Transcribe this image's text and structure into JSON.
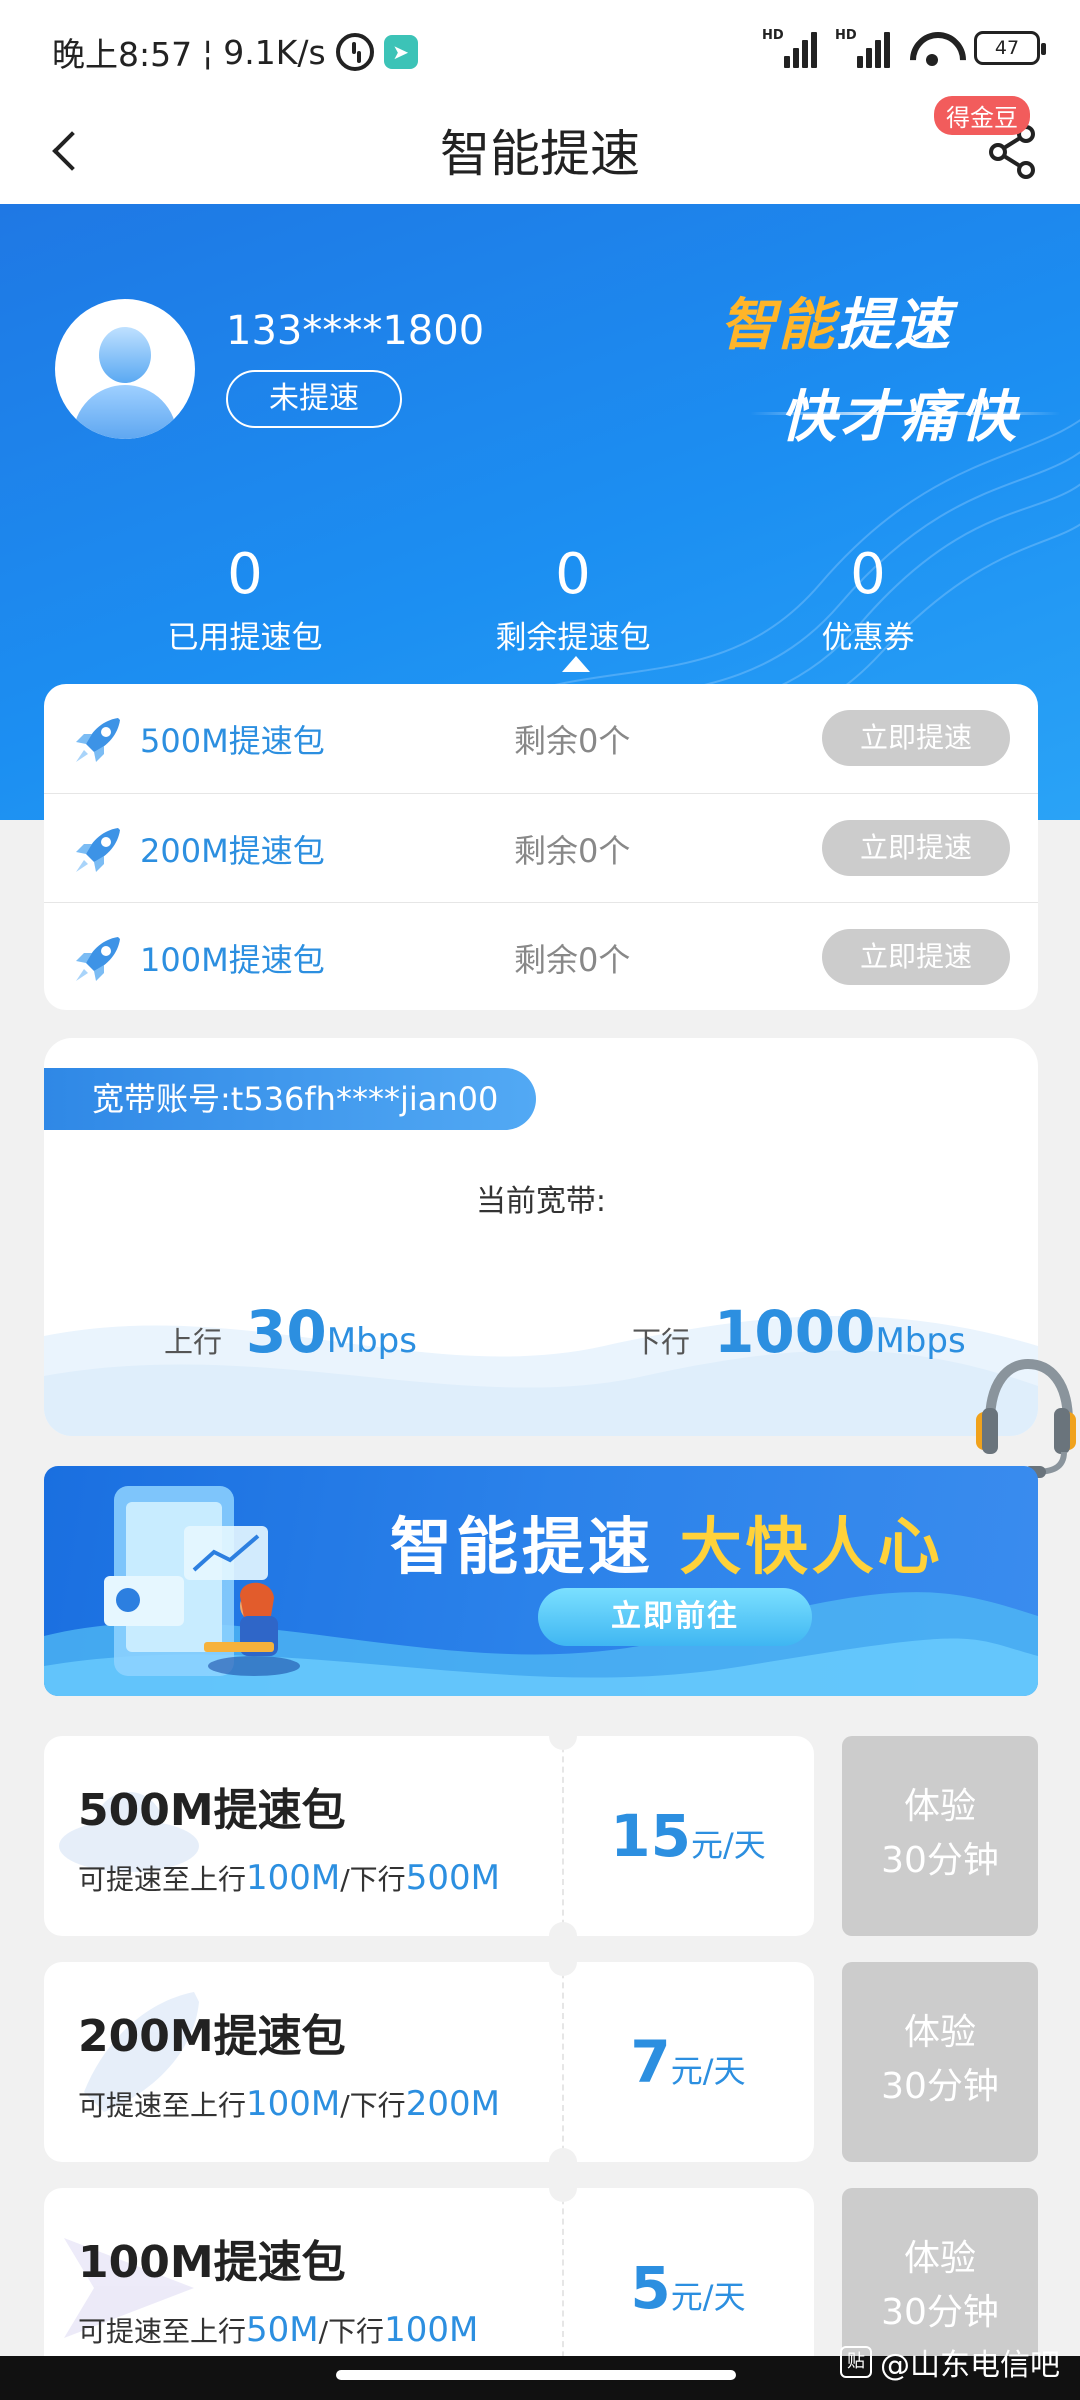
{
  "status_bar": {
    "time": "晚上8:57",
    "net_speed": "9.1K/s",
    "signal1_label": "HD",
    "signal2_label": "HD",
    "battery": "47"
  },
  "header": {
    "title": "智能提速",
    "badge": "得金豆"
  },
  "hero": {
    "phone": "133****1800",
    "speed_status": "未提速",
    "slogan_line1_a": "智能",
    "slogan_line1_b": "提速",
    "slogan_line2": "快才痛快",
    "stats": [
      {
        "value": "0",
        "label": "已用提速包"
      },
      {
        "value": "0",
        "label": "剩余提速包"
      },
      {
        "value": "0",
        "label": "优惠券"
      }
    ]
  },
  "packages": [
    {
      "name": "500M提速包",
      "remaining": "剩余0个",
      "button": "立即提速"
    },
    {
      "name": "200M提速包",
      "remaining": "剩余0个",
      "button": "立即提速"
    },
    {
      "name": "100M提速包",
      "remaining": "剩余0个",
      "button": "立即提速"
    }
  ],
  "broadband": {
    "account": "宽带账号:t536fh****jian00",
    "current_label": "当前宽带:",
    "up_label": "上行",
    "up_value": "30",
    "up_unit": "Mbps",
    "down_label": "下行",
    "down_value": "1000",
    "down_unit": "Mbps"
  },
  "banner": {
    "title_a": "智能提速",
    "title_b": "大快人心",
    "button": "立即前往"
  },
  "offers": [
    {
      "title": "500M提速包",
      "desc_prefix": "可提速至上行",
      "up": "100M",
      "sep": "/下行",
      "down": "500M",
      "price": "15",
      "unit": "元/天",
      "trial_line1": "体验",
      "trial_line2": "30分钟"
    },
    {
      "title": "200M提速包",
      "desc_prefix": "可提速至上行",
      "up": "100M",
      "sep": "/下行",
      "down": "200M",
      "price": "7",
      "unit": "元/天",
      "trial_line1": "体验",
      "trial_line2": "30分钟"
    },
    {
      "title": "100M提速包",
      "desc_prefix": "可提速至上行",
      "up": "50M",
      "sep": "/下行",
      "down": "100M",
      "price": "5",
      "unit": "元/天",
      "trial_line1": "体验",
      "trial_line2": "30分钟"
    }
  ],
  "watermark": {
    "icon_text": "贴",
    "text": "@山东电信吧"
  },
  "colors": {
    "accent": "#2c8fe0",
    "hero_blue": "#1f78e4",
    "disabled_grey": "#cccccc",
    "badge_red": "#f25c5c",
    "slogan_orange": "#ffb529"
  }
}
